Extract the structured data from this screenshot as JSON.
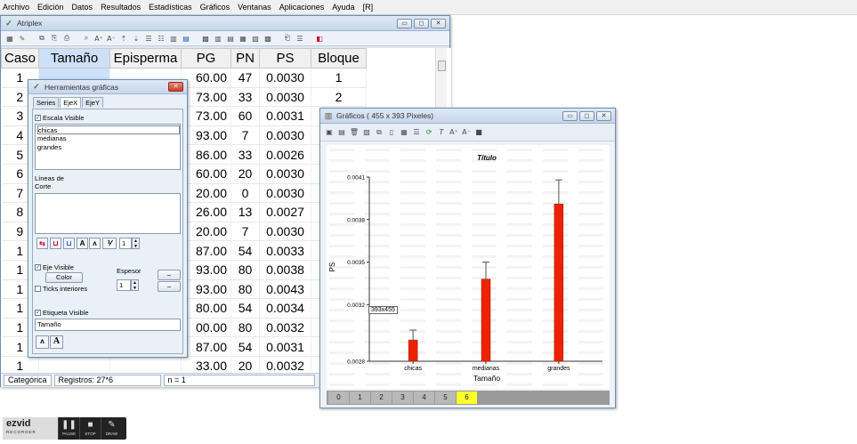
{
  "menubar": [
    "Archivo",
    "Edición",
    "Datos",
    "Resultados",
    "Estadísticas",
    "Gráficos",
    "Ventanas",
    "Aplicaciones",
    "Ayuda",
    "[R]"
  ],
  "atriplex": {
    "title": "Atriplex",
    "columns": [
      "Caso",
      "Tamaño",
      "Episperma",
      "PG",
      "PN",
      "PS",
      "Bloque"
    ],
    "rows": [
      {
        "caso": "1",
        "tam": "",
        "epi": "",
        "pg": "60.00",
        "pn": "47",
        "ps": "0.0030",
        "blo": "1"
      },
      {
        "caso": "2",
        "tam": "",
        "epi": "",
        "pg": "73.00",
        "pn": "33",
        "ps": "0.0030",
        "blo": "2"
      },
      {
        "caso": "3",
        "tam": "",
        "epi": "",
        "pg": "73.00",
        "pn": "60",
        "ps": "0.0031",
        "blo": ""
      },
      {
        "caso": "4",
        "tam": "",
        "epi": "",
        "pg": "93.00",
        "pn": "7",
        "ps": "0.0030",
        "blo": ""
      },
      {
        "caso": "5",
        "tam": "",
        "epi": "",
        "pg": "86.00",
        "pn": "33",
        "ps": "0.0026",
        "blo": ""
      },
      {
        "caso": "6",
        "tam": "",
        "epi": "",
        "pg": "60.00",
        "pn": "20",
        "ps": "0.0030",
        "blo": ""
      },
      {
        "caso": "7",
        "tam": "",
        "epi": "",
        "pg": "20.00",
        "pn": "0",
        "ps": "0.0030",
        "blo": ""
      },
      {
        "caso": "8",
        "tam": "",
        "epi": "",
        "pg": "26.00",
        "pn": "13",
        "ps": "0.0027",
        "blo": ""
      },
      {
        "caso": "9",
        "tam": "",
        "epi": "",
        "pg": "20.00",
        "pn": "7",
        "ps": "0.0030",
        "blo": ""
      },
      {
        "caso": "1",
        "tam": "",
        "epi": "",
        "pg": "87.00",
        "pn": "54",
        "ps": "0.0033",
        "blo": ""
      },
      {
        "caso": "1",
        "tam": "",
        "epi": "",
        "pg": "93.00",
        "pn": "80",
        "ps": "0.0038",
        "blo": ""
      },
      {
        "caso": "1",
        "tam": "",
        "epi": "",
        "pg": "93.00",
        "pn": "80",
        "ps": "0.0043",
        "blo": ""
      },
      {
        "caso": "1",
        "tam": "",
        "epi": "",
        "pg": "80.00",
        "pn": "54",
        "ps": "0.0034",
        "blo": ""
      },
      {
        "caso": "1",
        "tam": "",
        "epi": "",
        "pg": "00.00",
        "pn": "80",
        "ps": "0.0032",
        "blo": ""
      },
      {
        "caso": "1",
        "tam": "",
        "epi": "",
        "pg": "87.00",
        "pn": "54",
        "ps": "0.0031",
        "blo": ""
      },
      {
        "caso": "1",
        "tam": "",
        "epi": "",
        "pg": "33.00",
        "pn": "20",
        "ps": "0.0032",
        "blo": ""
      }
    ],
    "status": {
      "left": "Categórica",
      "records": "Registros: 27*6",
      "n": "n = 1"
    }
  },
  "herramientas": {
    "title": "Herramientas gráficas",
    "tabs": [
      "Series",
      "EjeX",
      "EjeY"
    ],
    "escala_visible": "Escala Visible",
    "escala_items": [
      "chicas",
      "medianas",
      "grandes"
    ],
    "lineas_label": "Líneas de",
    "corte_label": "Corte",
    "spin_value": "1",
    "eje_visible": "Eje Visible",
    "espesor": "Espesor",
    "color_btn": "Color",
    "espesor_value": "1",
    "ticks_interiores": "Ticks interiores",
    "etiqueta_visible": "Etiqueta Visible",
    "etiqueta_value": "Tamaño",
    "font_btn_a": "A"
  },
  "graficos": {
    "title": "Gráficos ( 455 x 393 Pixeles)",
    "tooltip": "393x455",
    "page_tabs": [
      "0",
      "1",
      "2",
      "3",
      "4",
      "5",
      "6"
    ],
    "active_tab": "6"
  },
  "chart_data": {
    "type": "bar",
    "title": "Título",
    "xlabel": "Tamaño",
    "ylabel": "PS",
    "categories": [
      "chicas",
      "medianas",
      "grandes"
    ],
    "values": [
      0.00295,
      0.00338,
      0.00391
    ],
    "error": [
      7e-05,
      0.00012,
      0.00017
    ],
    "ylim": [
      0.0028,
      0.0041
    ],
    "yticks": [
      "0.0028",
      "0.0032",
      "0.0035",
      "0.0038",
      "0.0041"
    ],
    "bar_color": "#ee2200"
  },
  "ezvid": {
    "logo": "ezvid",
    "sub": "RECORDER",
    "pause": "PAUSE",
    "stop": "STOP",
    "draw": "DRAW"
  }
}
